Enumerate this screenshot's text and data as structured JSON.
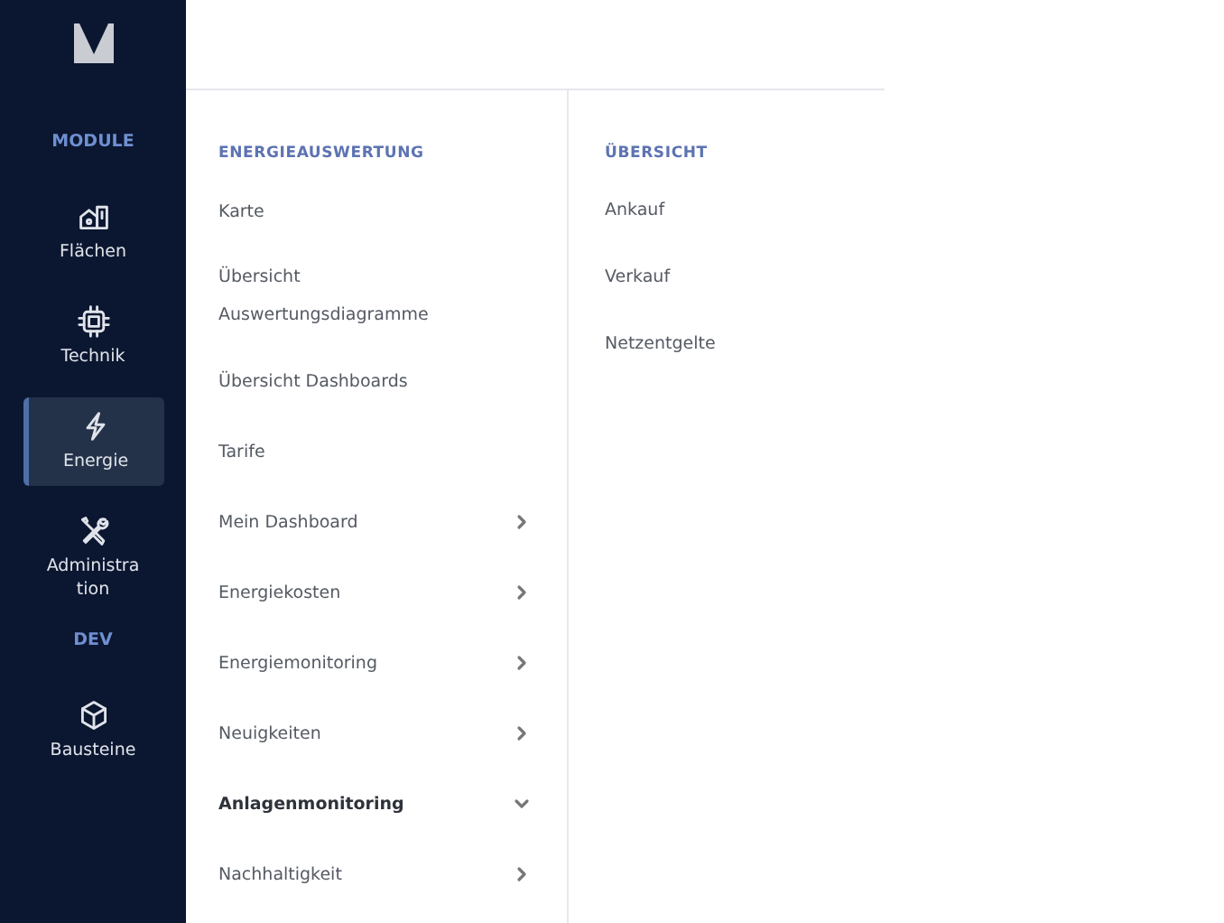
{
  "sidebar": {
    "items": [
      {
        "kind": "section",
        "label": "MODULE"
      },
      {
        "kind": "nav",
        "label": "Flächen",
        "selected": false
      },
      {
        "kind": "nav",
        "label": "Technik",
        "selected": false
      },
      {
        "kind": "nav",
        "label": "Energie",
        "selected": true
      },
      {
        "kind": "nav",
        "label": "Administra\ntion",
        "selected": false
      },
      {
        "kind": "section",
        "label": "DEV"
      },
      {
        "kind": "nav",
        "label": "Bausteine",
        "selected": false
      }
    ]
  },
  "menu": {
    "title": "ENERGIEAUSWERTUNG",
    "items": [
      {
        "kind": "link",
        "label": "Karte"
      },
      {
        "kind": "link",
        "label": "Übersicht\nAuswertungsdiagramme"
      },
      {
        "kind": "link",
        "label": "Übersicht Dashboards"
      },
      {
        "kind": "link",
        "label": "Tarife"
      },
      {
        "kind": "group",
        "label": "Mein Dashboard",
        "expanded": false
      },
      {
        "kind": "group",
        "label": "Energiekosten",
        "expanded": false
      },
      {
        "kind": "group",
        "label": "Energiemonitoring",
        "expanded": false
      },
      {
        "kind": "group",
        "label": "Neuigkeiten",
        "expanded": false
      },
      {
        "kind": "group",
        "label": "Anlagenmonitoring",
        "expanded": true
      },
      {
        "kind": "group",
        "label": "Nachhaltigkeit",
        "expanded": false
      }
    ]
  },
  "submenu": {
    "title": "ÜBERSICHT",
    "items": [
      "Ankauf",
      "Verkauf",
      "Netzentgelte"
    ]
  }
}
